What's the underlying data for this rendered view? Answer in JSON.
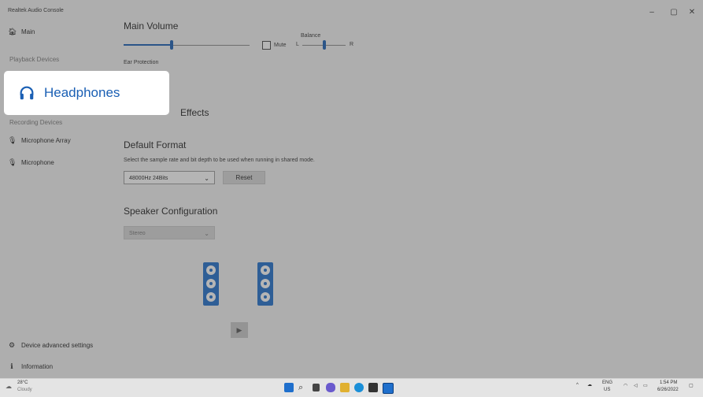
{
  "app": {
    "title": "Realtek Audio Console"
  },
  "window_controls": {
    "minimize": "–",
    "maximize": "▢",
    "close": "✕"
  },
  "sidebar": {
    "main_label": "Main",
    "playback_section": "Playback Devices",
    "recording_section": "Recording Devices",
    "recording_items": [
      "Microphone Array",
      "Microphone"
    ],
    "bottom_items": [
      "Device advanced settings",
      "Information"
    ]
  },
  "highlight": {
    "label": "Headphones"
  },
  "main": {
    "volume_title": "Main Volume",
    "volume_level": 0.38,
    "mute_label": "Mute",
    "balance_label": "Balance",
    "balance_left": "L",
    "balance_right": "R",
    "balance_level": 0.5,
    "ear_protection": "Ear Protection",
    "effects_title": "Effects",
    "default_format_title": "Default Format",
    "default_format_desc": "Select the sample rate and bit depth to be used when running in shared mode.",
    "format_value": "48000Hz 24Bits",
    "reset_label": "Reset",
    "speaker_config_title": "Speaker Configuration",
    "speaker_config_value": "Stereo"
  },
  "taskbar": {
    "weather_temp": "28°C",
    "weather_desc": "Cloudy",
    "lang_top": "ENG",
    "lang_bottom": "US",
    "time": "1:54 PM",
    "date": "6/26/2022"
  },
  "colors": {
    "accent": "#1a5fb4",
    "speaker": "#1f6fcc"
  }
}
